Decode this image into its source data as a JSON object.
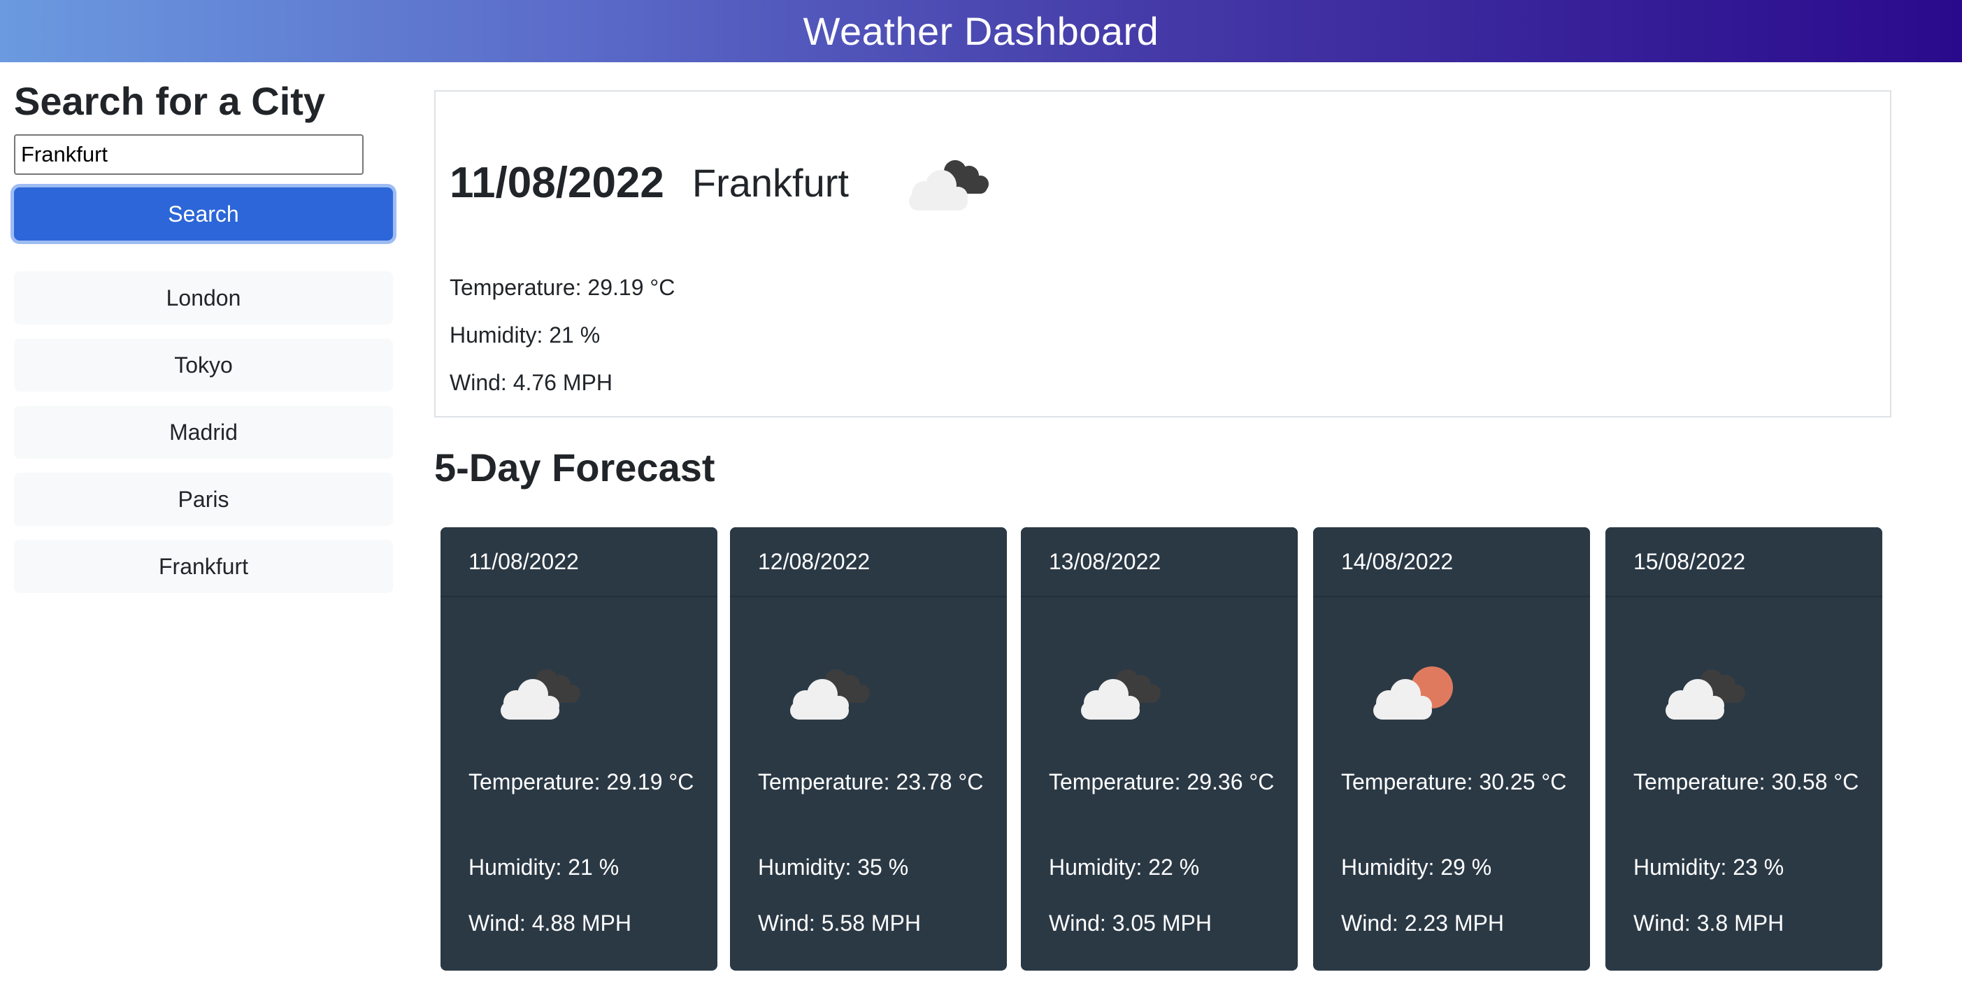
{
  "header": {
    "title": "Weather Dashboard"
  },
  "sidebar": {
    "heading": "Search for a City",
    "search_value": "Frankfurt",
    "search_button": "Search",
    "history": [
      "London",
      "Tokyo",
      "Madrid",
      "Paris",
      "Frankfurt"
    ]
  },
  "current": {
    "date": "11/08/2022",
    "city": "Frankfurt",
    "icon": "clouds-icon",
    "temperature": "Temperature: 29.19 °C",
    "humidity": "Humidity: 21 %",
    "wind": "Wind: 4.76 MPH"
  },
  "forecast": {
    "title": "5-Day Forecast",
    "days": [
      {
        "date": "11/08/2022",
        "icon": "clouds-icon",
        "temperature": "Temperature: 29.19 °C",
        "humidity": "Humidity: 21 %",
        "wind": "Wind: 4.88 MPH"
      },
      {
        "date": "12/08/2022",
        "icon": "clouds-icon",
        "temperature": "Temperature: 23.78 °C",
        "humidity": "Humidity: 35 %",
        "wind": "Wind: 5.58 MPH"
      },
      {
        "date": "13/08/2022",
        "icon": "clouds-icon",
        "temperature": "Temperature: 29.36 °C",
        "humidity": "Humidity: 22 %",
        "wind": "Wind: 3.05 MPH"
      },
      {
        "date": "14/08/2022",
        "icon": "partly-cloudy-icon",
        "temperature": "Temperature: 30.25 °C",
        "humidity": "Humidity: 29 %",
        "wind": "Wind: 2.23 MPH"
      },
      {
        "date": "15/08/2022",
        "icon": "clouds-icon",
        "temperature": "Temperature: 30.58 °C",
        "humidity": "Humidity: 23 %",
        "wind": "Wind: 3.8 MPH"
      }
    ]
  },
  "colors": {
    "accent": "#2c66d8",
    "card_bg": "#2b3945",
    "sun": "#e07a5f"
  }
}
